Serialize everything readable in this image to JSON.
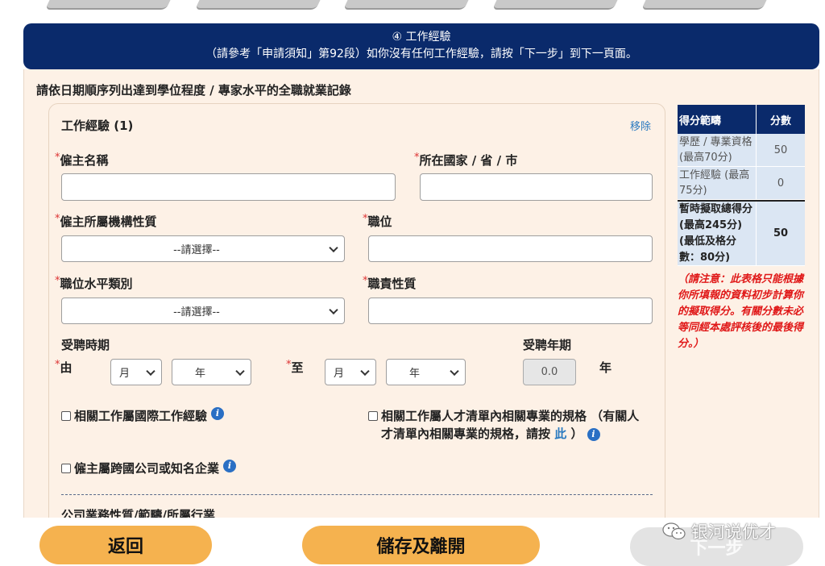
{
  "banner": {
    "title": "④ 工作經驗",
    "subtitle": "（請參考「申請須知」第92段）如你沒有任何工作經驗，請按「下一步」到下一頁面。"
  },
  "panel": {
    "title": "請依日期順序列出達到學位程度 / 專家水平的全職就業記錄"
  },
  "card": {
    "title": "工作經驗 (1)",
    "remove_label": "移除",
    "required_mark": "*",
    "employer_name_label": "僱主名稱",
    "location_label": "所在國家 / 省 / 巿",
    "org_nature_label": "僱主所屬機構性質",
    "org_nature_value": "--請選擇--",
    "position_label": "職位",
    "position_level_label": "職位水平類別",
    "position_level_value": "--請選擇--",
    "duty_nature_label": "職責性質",
    "period_label": "受聘時期",
    "from_label": "由",
    "to_label": "至",
    "month_placeholder": "月",
    "year_placeholder": "年",
    "years_label": "受聘年期",
    "years_value": "0.0",
    "years_unit": "年",
    "check_international": "相關工作屬國際工作經驗",
    "check_talent_list_a": "相關工作屬人才清單內相關專業的規格 （有關人才清單內相關專業的規格，請按",
    "check_talent_list_link": "此",
    "check_talent_list_b": "）",
    "check_multinational": "僱主屬跨國公司或知名企業",
    "next_section_cut": "公司業務性質/範疇/所屬行業"
  },
  "score_table": {
    "header_range": "得分範疇",
    "header_score": "分數",
    "rows": [
      {
        "label": "學歷 / 專業資格 (最高70分)",
        "score": "50"
      },
      {
        "label": "工作經驗 (最高75分)",
        "score": "0"
      }
    ],
    "total_label": "暫時擬取總得分 (最高245分) (最低及格分數：80分)",
    "total_score": "50",
    "note": "（請注意：此表格只能根據你所填報的資料初步計算你的擬取得分。有關分數未必等同經本處評核後的最後得分。）"
  },
  "buttons": {
    "back": "返回",
    "save_exit": "儲存及離開",
    "next": "下一步"
  },
  "watermark": "银河说优才",
  "colors": {
    "banner": "#0a2a6b",
    "panel": "#fdf1e6",
    "button": "#f5b24f",
    "link": "#2a7ac0",
    "note": "#e01818"
  }
}
